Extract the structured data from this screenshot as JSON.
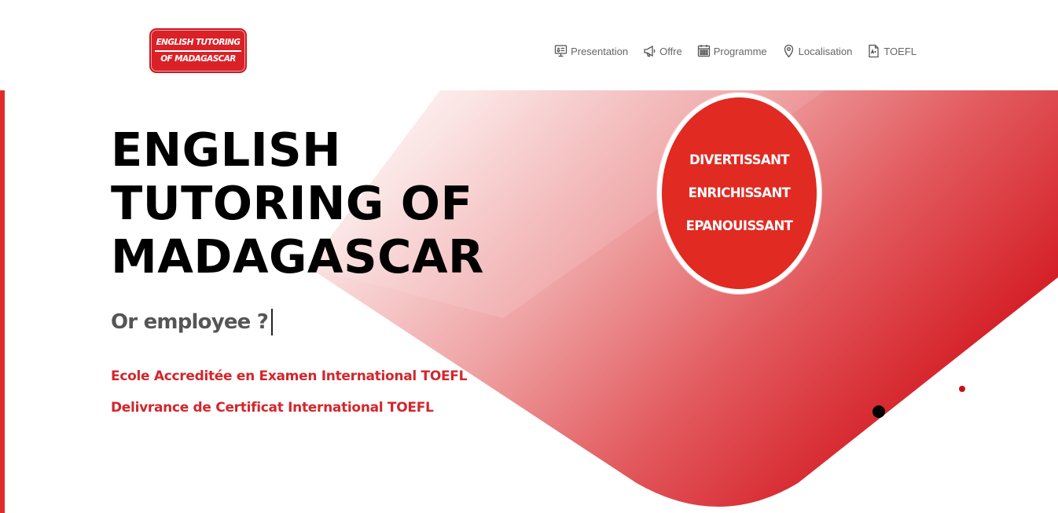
{
  "logo": {
    "line1": "ENGLISH TUTORING",
    "line2": "OF MADAGASCAR",
    "icon": "ribbon-logo"
  },
  "nav": {
    "items": [
      {
        "label": "Presentation",
        "icon": "presentation-board-icon"
      },
      {
        "label": "Offre",
        "icon": "megaphone-icon"
      },
      {
        "label": "Programme",
        "icon": "calendar-grid-icon"
      },
      {
        "label": "Localisation",
        "icon": "map-pin-icon"
      },
      {
        "label": "TOEFL",
        "icon": "document-icon"
      }
    ]
  },
  "hero": {
    "title_lines": [
      "ENGLISH",
      "TUTORING OF",
      "MADAGASCAR"
    ],
    "typed_text": "Or employee ?",
    "accreditation_1": "Ecole Accreditée en Examen International TOEFL",
    "accreditation_2": "Delivrance de Certificat International TOEFL"
  },
  "badge": {
    "words": [
      "DIVERTISSANT",
      "ENRICHISSANT",
      "EPANOUISSANT"
    ]
  },
  "colors": {
    "brand_red": "#e02a22",
    "text_red": "#d3262c",
    "title_black": "#000000",
    "subtitle_gray": "#555555",
    "nav_gray": "#666666"
  }
}
